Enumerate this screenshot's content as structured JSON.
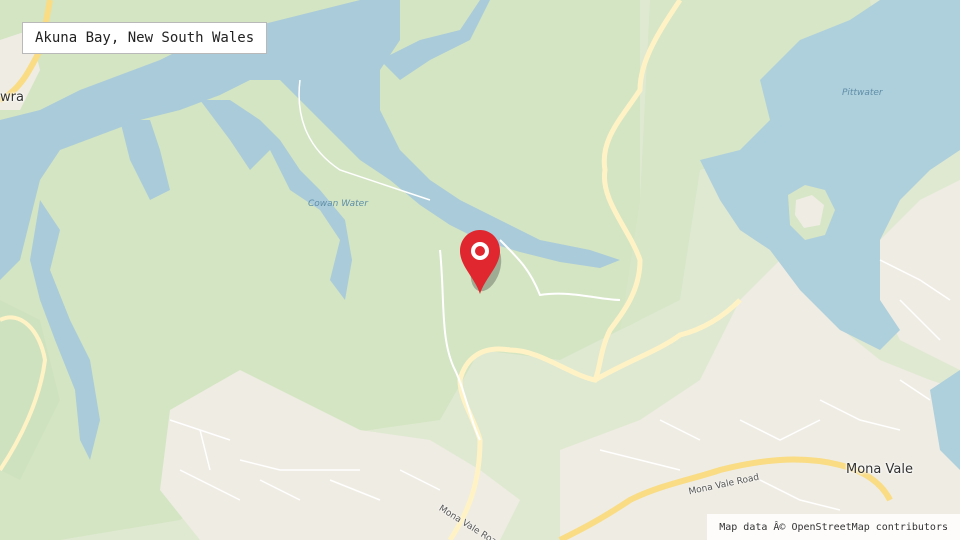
{
  "map": {
    "title": "Akuna Bay, New South Wales",
    "attribution": "Map data Â© OpenStreetMap contributors",
    "labels": {
      "cowan_water": "Cowan Water",
      "pittwater": "Pittwater",
      "mona_vale": "Mona Vale",
      "mona_vale_road_east": "Mona Vale Road",
      "mona_vale_road_south": "Mona Vale Road",
      "partial_town": "wra"
    },
    "marker": {
      "icon": "map-pin-icon",
      "color": "#e0262e"
    },
    "colors": {
      "land": "#dfe9d1",
      "forest": "#d2e4c1",
      "water": "#aacbd9",
      "urban": "#f1ede4",
      "road_major": "#fbe6a6",
      "road_minor": "#ffffff"
    }
  }
}
